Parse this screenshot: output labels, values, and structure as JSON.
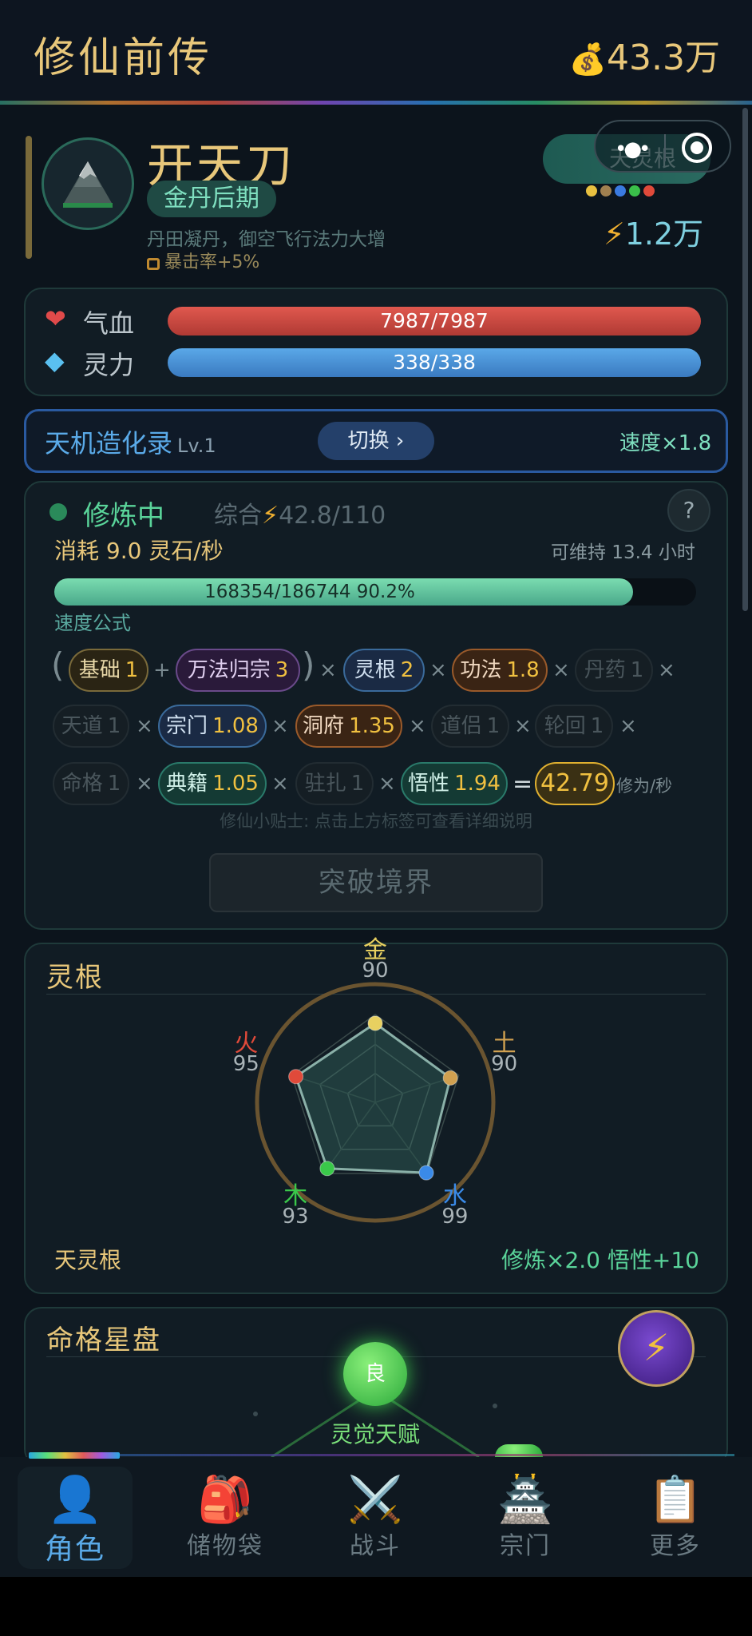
{
  "header": {
    "title": "修仙前传",
    "currency_icon": "💰",
    "currency": "43.3万"
  },
  "character": {
    "name": "开天刀",
    "realm": "金丹后期",
    "realm_desc": "丹田凝丹，御空飞行法力大增",
    "crit_bonus": "暴击率+5%",
    "root_badge": "天灵根",
    "root_dot_colors": [
      "#e8c040",
      "#a08050",
      "#3a7ae0",
      "#3ac04a",
      "#e04a3a"
    ],
    "power": "1.2万"
  },
  "stats": {
    "hp_label": "气血",
    "hp_value": "7987/7987",
    "hp_ratio": 1.0,
    "mp_label": "灵力",
    "mp_value": "338/338",
    "mp_ratio": 1.0
  },
  "technique": {
    "name": "天机造化录",
    "level": "Lv.1",
    "switch_label": "切换 ›",
    "speed": "速度×1.8"
  },
  "cultivation": {
    "status": "修炼中",
    "total_label": "综合",
    "total_value": "42.8/110",
    "help": "?",
    "consume": "消耗 9.0 灵石/秒",
    "sustain": "可维持 13.4 小时",
    "progress_text": "168354/186744  90.2%",
    "progress_ratio": 0.902,
    "formula_label": "速度公式",
    "formula": {
      "base": {
        "name": "基础",
        "value": "1"
      },
      "wanfa": {
        "name": "万法归宗",
        "value": "3"
      },
      "root": {
        "name": "灵根",
        "value": "2"
      },
      "gongfa": {
        "name": "功法",
        "value": "1.8"
      },
      "danyao": {
        "name": "丹药",
        "value": "1"
      },
      "tiandao": {
        "name": "天道",
        "value": "1"
      },
      "zongmen": {
        "name": "宗门",
        "value": "1.08"
      },
      "dongfu": {
        "name": "洞府",
        "value": "1.35"
      },
      "daolv": {
        "name": "道侣",
        "value": "1"
      },
      "lunhui": {
        "name": "轮回",
        "value": "1"
      },
      "mingge": {
        "name": "命格",
        "value": "1"
      },
      "dianji": {
        "name": "典籍",
        "value": "1.05"
      },
      "zhuzha": {
        "name": "驻扎",
        "value": "1"
      },
      "wuxing": {
        "name": "悟性",
        "value": "1.94"
      },
      "result": "42.79",
      "unit": "修为/秒"
    },
    "tip": "修仙小贴士: 点击上方标签可查看详细说明",
    "breakthrough": "突破境界"
  },
  "spirit_root": {
    "title": "灵根",
    "elements": [
      {
        "name": "金",
        "value": 90,
        "color": "#e8d060"
      },
      {
        "name": "土",
        "value": 90,
        "color": "#d0a050"
      },
      {
        "name": "水",
        "value": 99,
        "color": "#3a8ae8"
      },
      {
        "name": "木",
        "value": 93,
        "color": "#3ac84a"
      },
      {
        "name": "火",
        "value": 95,
        "color": "#e04a3a"
      }
    ],
    "max": 100,
    "type": "天灵根",
    "bonus": "修炼×2.0  悟性+10"
  },
  "destiny": {
    "title": "命格星盘",
    "node_label": "良",
    "node_name": "灵觉天赋"
  },
  "nav": [
    {
      "label": "角色",
      "icon": "👤"
    },
    {
      "label": "储物袋",
      "icon": "🎒"
    },
    {
      "label": "战斗",
      "icon": "⚔️"
    },
    {
      "label": "宗门",
      "icon": "🏯"
    },
    {
      "label": "更多",
      "icon": "📋"
    }
  ]
}
